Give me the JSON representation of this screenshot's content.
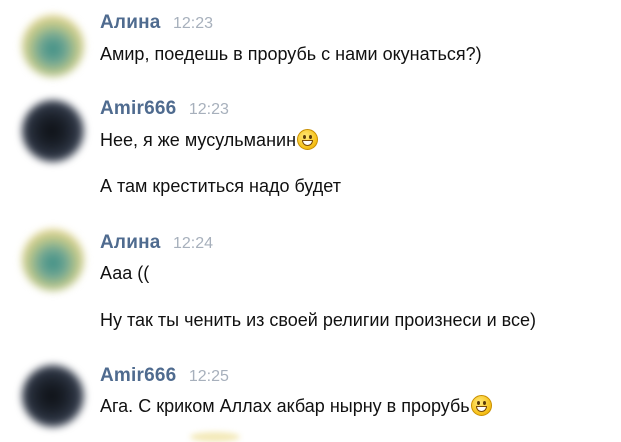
{
  "messages": [
    {
      "author": "Алина",
      "time": "12:23",
      "avatar_icon": "user-avatar-alina",
      "lines": [
        "Амир, поедешь в прорубь с нами окунаться?)"
      ]
    },
    {
      "author": "Amir666",
      "time": "12:23",
      "avatar_icon": "user-avatar-amir",
      "lines": [
        "Нее, я же мусульманин",
        "А там креститься надо будет"
      ],
      "emoji_after_line": 0,
      "emoji_name": "grinning-face-emoji"
    },
    {
      "author": "Алина",
      "time": "12:24",
      "avatar_icon": "user-avatar-alina",
      "lines": [
        "Ааа ((",
        "Ну так ты ченить из своей религии произнеси и все)"
      ]
    },
    {
      "author": "Amir666",
      "time": "12:25",
      "avatar_icon": "user-avatar-amir",
      "lines": [
        "Ага. С криком Аллах акбар нырну в прорубь"
      ],
      "emoji_after_line": 0,
      "emoji_name": "grinning-face-emoji"
    }
  ],
  "colors": {
    "author_name": "#4f6b8f",
    "timestamp": "#a7b0bc",
    "message_text": "#111111",
    "background": "#ffffff"
  }
}
